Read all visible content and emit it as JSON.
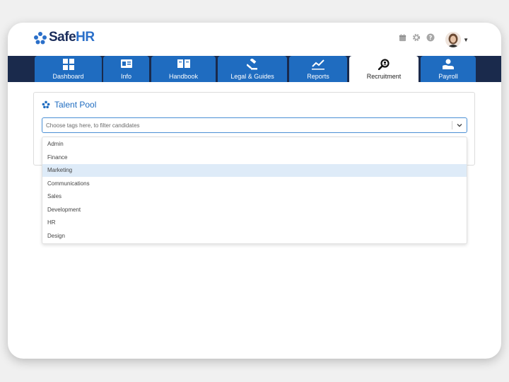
{
  "brand": {
    "name_main": "Safe",
    "name_accent": "HR",
    "color_dark": "#1a2c5a",
    "color_accent": "#2a6fc9"
  },
  "header": {
    "icons": [
      "calendar-icon",
      "gear-icon",
      "help-icon"
    ],
    "avatar": "user-avatar"
  },
  "nav": {
    "bar_color": "#1a2a4c",
    "tab_color": "#1f6cc0",
    "tabs": [
      {
        "label": "Dashboard",
        "icon": "grid-icon",
        "active": false
      },
      {
        "label": "Info",
        "icon": "id-card-icon",
        "active": false
      },
      {
        "label": "Handbook",
        "icon": "book-icon",
        "active": false
      },
      {
        "label": "Legal & Guides",
        "icon": "gavel-icon",
        "active": false
      },
      {
        "label": "Reports",
        "icon": "chart-line-icon",
        "active": false
      },
      {
        "label": "Recruitment",
        "icon": "search-icon",
        "active": true
      },
      {
        "label": "Payroll",
        "icon": "payroll-icon",
        "active": false
      }
    ]
  },
  "talent_pool": {
    "title": "Talent Pool",
    "tag_input": {
      "value": "",
      "placeholder": "Choose tags here, to filter candidates"
    },
    "options": [
      "Admin",
      "Finance",
      "Marketing",
      "Communications",
      "Sales",
      "Development",
      "HR",
      "Design"
    ],
    "highlighted_option": "Marketing"
  }
}
